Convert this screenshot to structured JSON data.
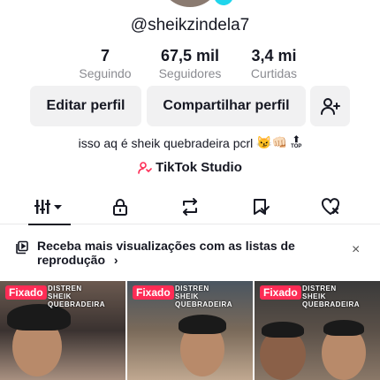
{
  "profile": {
    "username": "@sheikzindela7",
    "bio": "isso aq é sheik quebradeira pcrl",
    "bio_emojis": "😼👊🏻",
    "bio_top_badge": "TOP",
    "studio_label": "TikTok Studio"
  },
  "stats": [
    {
      "value": "7",
      "label": "Seguindo"
    },
    {
      "value": "67,5 mil",
      "label": "Seguidores"
    },
    {
      "value": "3,4 mi",
      "label": "Curtidas"
    }
  ],
  "buttons": {
    "edit": "Editar perfil",
    "share": "Compartilhar perfil"
  },
  "tabs": [
    {
      "icon": "videos-grid-icon",
      "active": true
    },
    {
      "icon": "lock-icon",
      "active": false
    },
    {
      "icon": "repost-icon",
      "active": false
    },
    {
      "icon": "favorites-icon",
      "active": false
    },
    {
      "icon": "liked-icon",
      "active": false
    }
  ],
  "promo": {
    "text": "Receba mais visualizações com as listas de reprodução",
    "chevron": "›",
    "close": "×"
  },
  "videos": [
    {
      "pinned_label": "Fixado",
      "overlay_line1": "DISTREN",
      "overlay_line2": "SHEIK QUEBRADEIRA"
    },
    {
      "pinned_label": "Fixado",
      "overlay_line1": "DISTREN",
      "overlay_line2": "SHEIK QUEBRADEIRA"
    },
    {
      "pinned_label": "Fixado",
      "overlay_line1": "DISTREN",
      "overlay_line2": "SHEIK QUEBRADEIRA"
    }
  ],
  "colors": {
    "accent": "#fe2c55",
    "button_bg": "#f1f1f2",
    "secondary_text": "#8a8b91"
  }
}
